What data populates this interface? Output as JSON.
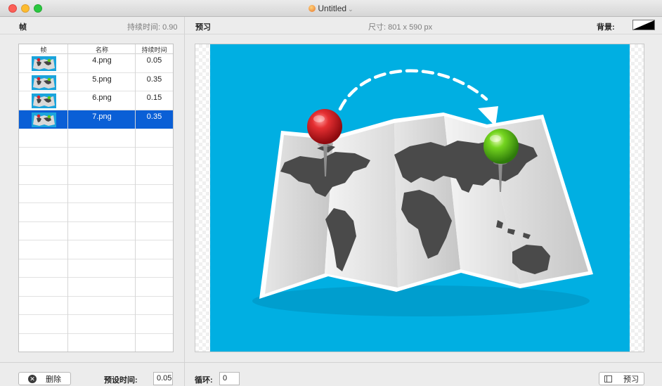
{
  "window": {
    "title": "Untitled",
    "title_icon": "document-icon"
  },
  "frames_header": {
    "label": "帧",
    "duration_text": "持续时间: 0.90"
  },
  "preview_header": {
    "label": "预习",
    "size_text": "尺寸: 801 x 590 px",
    "background_label": "背景:"
  },
  "table": {
    "columns": [
      "帧",
      "名称",
      "持续时间"
    ],
    "rows": [
      {
        "name": "4.png",
        "duration": "0.05"
      },
      {
        "name": "5.png",
        "duration": "0.35"
      },
      {
        "name": "6.png",
        "duration": "0.15"
      },
      {
        "name": "7.png",
        "duration": "0.35"
      }
    ],
    "selected_index": 3
  },
  "bottom_left": {
    "delete_label": "删除",
    "preset_label": "预设时间:",
    "preset_value": "0.05"
  },
  "bottom_right": {
    "loop_label": "循环:",
    "loop_value": "0",
    "preview_label": "预习"
  },
  "colors": {
    "selection": "#0a5fd6",
    "canvas_bg": "#00afe2",
    "pin_red": "#d8202a",
    "pin_green": "#5cc814"
  }
}
